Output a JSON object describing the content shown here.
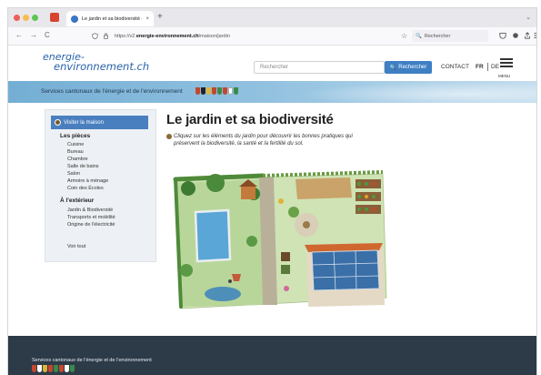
{
  "browser": {
    "tab_title": "Le jardin et sa biodiversité – en",
    "tab_close": "×",
    "new_tab": "+",
    "tabs_menu": "⌄",
    "nav_back": "←",
    "nav_forward": "→",
    "nav_reload": "C",
    "url_prefix": "https://v2.",
    "url_domain": "energie-environnement.ch",
    "url_path": "/maison/jardin",
    "bookmark_icon": "☆",
    "search_placeholder": "Rechercher",
    "search_icon": "🔍"
  },
  "site": {
    "logo_line1": "energie-",
    "logo_line2": "environnement.ch",
    "search_placeholder": "Rechercher",
    "search_button": "Rechercher",
    "search_icon": "🔍",
    "contact": "CONTACT",
    "lang_fr": "FR",
    "lang_de": "DE",
    "menu_label": "MENU"
  },
  "banner": {
    "text": "Services cantonaux de l'énergie et de l'environnement"
  },
  "sidebar": {
    "header": "Visiter la maison",
    "sections": [
      {
        "title": "Les pièces",
        "items": [
          "Cuisine",
          "Bureau",
          "Chambre",
          "Salle de bains",
          "Salon",
          "Armoire à ménage",
          "Coin des Écoles"
        ]
      },
      {
        "title": "À l'extérieur",
        "items": [
          "Jardin & Biodiversité",
          "Transports et mobilité",
          "Origine de l'électricité"
        ]
      }
    ],
    "extra": "Voir tout"
  },
  "main": {
    "title": "Le jardin et sa biodiversité",
    "intro": "Cliquez sur les éléments du jardin pour découvrir les bonnes pratiques qui préservent la biodiversité, la santé et la fertilité du sol."
  },
  "footer": {
    "text": "Services cantonaux de l'énergie et de l'environnement"
  },
  "colors": {
    "brand_blue": "#2a63a8",
    "search_button": "#3f7fc4",
    "sidebar_header": "#4a7fbf",
    "footer_bg": "#2d3a47",
    "crests": [
      "#c4462f",
      "#222222",
      "#e0b33a",
      "#c4462f",
      "#3a8a4a",
      "#c4462f",
      "#ffffff",
      "#3d7fc4"
    ]
  }
}
